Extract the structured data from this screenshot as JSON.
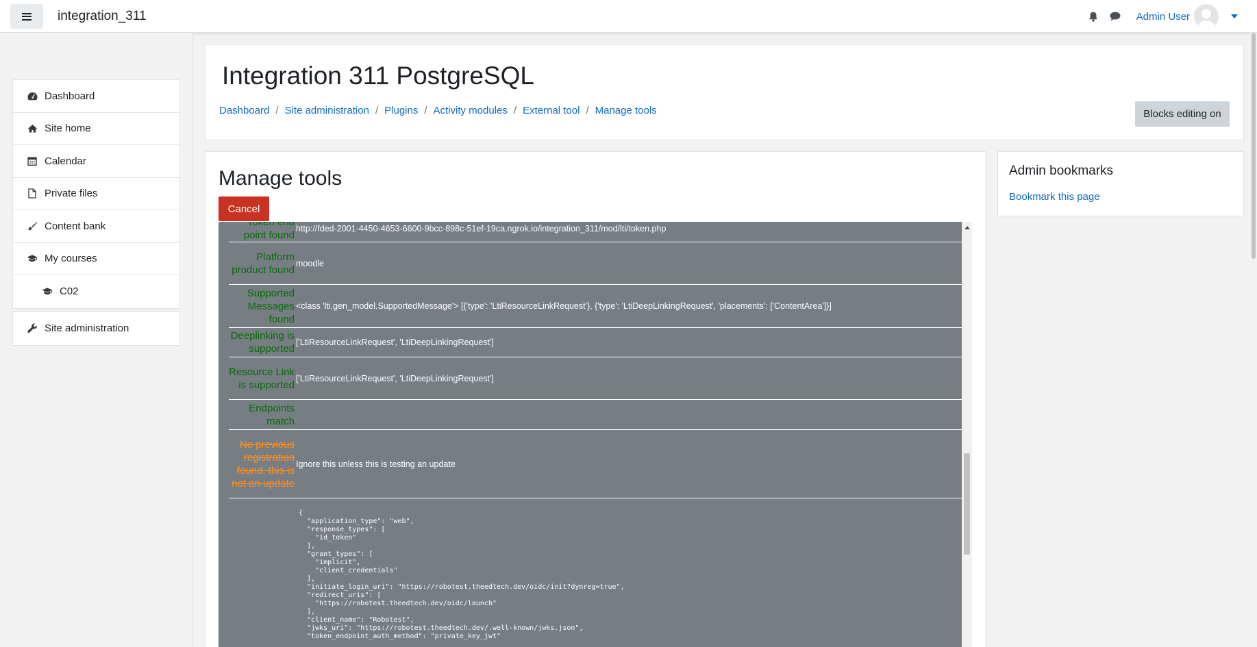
{
  "navbar": {
    "site_name": "integration_311",
    "user_name": "Admin User"
  },
  "sidebar": {
    "items": [
      {
        "label": "Dashboard",
        "icon": "dashboard-icon"
      },
      {
        "label": "Site home",
        "icon": "home-icon"
      },
      {
        "label": "Calendar",
        "icon": "calendar-icon"
      },
      {
        "label": "Private files",
        "icon": "file-icon"
      },
      {
        "label": "Content bank",
        "icon": "paintbrush-icon"
      },
      {
        "label": "My courses",
        "icon": "graduation-cap-icon"
      },
      {
        "label": "C02",
        "icon": "graduation-cap-icon"
      }
    ],
    "admin_item": {
      "label": "Site administration",
      "icon": "wrench-icon"
    }
  },
  "header": {
    "title": "Integration 311 PostgreSQL",
    "breadcrumb": [
      "Dashboard",
      "Site administration",
      "Plugins",
      "Activity modules",
      "External tool",
      "Manage tools"
    ],
    "blocks_editing_label": "Blocks editing on"
  },
  "main": {
    "title": "Manage tools",
    "cancel_label": "Cancel",
    "rows": [
      {
        "label": "Token end point found",
        "value": "http://fded-2001-4450-4653-6600-9bcc-898c-51ef-19ca.ngrok.io/integration_311/mod/lti/token.php",
        "status": "ok"
      },
      {
        "label": "Platform product found",
        "value": "moodle",
        "status": "ok"
      },
      {
        "label": "Supported Messages found",
        "value": "<class 'lti.gen_model.SupportedMessage'> [{'type': 'LtiResourceLinkRequest'}, {'type': 'LtiDeepLinkingRequest', 'placements': ['ContentArea']}]",
        "status": "ok"
      },
      {
        "label": "Deeplinking is supported",
        "value": "['LtiResourceLinkRequest', 'LtiDeepLinkingRequest']",
        "status": "ok"
      },
      {
        "label": "Resource Link is supported",
        "value": "['LtiResourceLinkRequest', 'LtiDeepLinkingRequest']",
        "status": "ok"
      },
      {
        "label": "Endpoints match",
        "value": "",
        "status": "ok"
      },
      {
        "label": "No previous registration found, this is not an update",
        "value": "Ignore this unless this is testing an update",
        "status": "warn"
      }
    ],
    "json_text": "{\n  \"application_type\": \"web\",\n  \"response_types\": [\n    \"id_token\"\n  ],\n  \"grant_types\": [\n    \"implicit\",\n    \"client_credentials\"\n  ],\n  \"initiate_login_uri\": \"https://robotest.theedtech.dev/oidc/init?dynreg=true\",\n  \"redirect_uris\": [\n    \"https://robotest.theedtech.dev/oidc/launch\"\n  ],\n  \"client_name\": \"Robotest\",\n  \"jwks_uri\": \"https://robotest.theedtech.dev/.well-known/jwks.json\",\n  \"token_endpoint_auth_method\": \"private_key_jwt\""
  },
  "bookmarks": {
    "title": "Admin bookmarks",
    "link_label": "Bookmark this page"
  },
  "colors": {
    "link": "#0f6cbf",
    "cancel": "#ca3120",
    "ok_label": "#0a6b0a",
    "warn_label": "#ff8f1f",
    "output_bg": "#767d83"
  }
}
